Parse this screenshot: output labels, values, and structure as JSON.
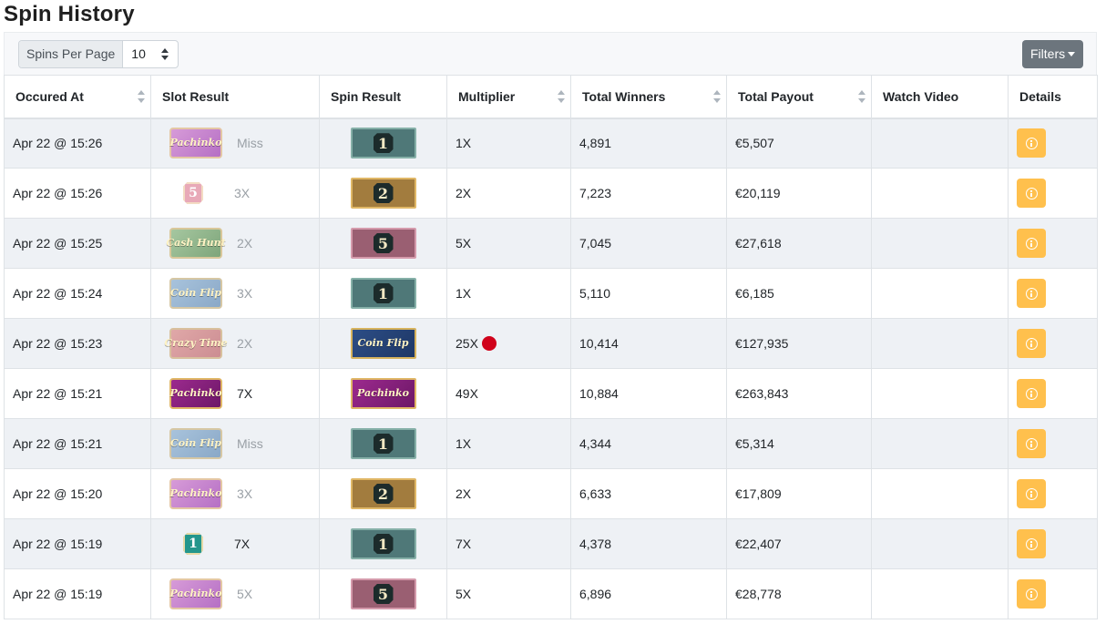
{
  "page": {
    "title": "Spin History"
  },
  "toolbar": {
    "spins_per_page_label": "Spins Per Page",
    "spins_per_page_value": "10",
    "filters_label": "Filters"
  },
  "table": {
    "headers": {
      "occured_at": "Occured At",
      "slot_result": "Slot Result",
      "spin_result": "Spin Result",
      "multiplier": "Multiplier",
      "total_winners": "Total Winners",
      "total_payout": "Total Payout",
      "watch_video": "Watch Video",
      "details": "Details"
    },
    "rows": [
      {
        "occured_at": "Apr 22 @ 15:26",
        "slot_result": "Pachinko",
        "slot_multiplier": "Miss",
        "slot_highlight": false,
        "spin_result": "1",
        "multiplier": "1X",
        "winners": "4,891",
        "payout": "€5,507",
        "has_dot": false
      },
      {
        "occured_at": "Apr 22 @ 15:26",
        "slot_result": "5",
        "slot_multiplier": "3X",
        "slot_highlight": false,
        "spin_result": "2",
        "multiplier": "2X",
        "winners": "7,223",
        "payout": "€20,119",
        "has_dot": false
      },
      {
        "occured_at": "Apr 22 @ 15:25",
        "slot_result": "Cash Hunt",
        "slot_multiplier": "2X",
        "slot_highlight": false,
        "spin_result": "5",
        "multiplier": "5X",
        "winners": "7,045",
        "payout": "€27,618",
        "has_dot": false
      },
      {
        "occured_at": "Apr 22 @ 15:24",
        "slot_result": "Coin Flip",
        "slot_multiplier": "3X",
        "slot_highlight": false,
        "spin_result": "1",
        "multiplier": "1X",
        "winners": "5,110",
        "payout": "€6,185",
        "has_dot": false
      },
      {
        "occured_at": "Apr 22 @ 15:23",
        "slot_result": "Crazy Time",
        "slot_multiplier": "2X",
        "slot_highlight": false,
        "spin_result": "Coin Flip",
        "multiplier": "25X",
        "winners": "10,414",
        "payout": "€127,935",
        "has_dot": true
      },
      {
        "occured_at": "Apr 22 @ 15:21",
        "slot_result": "Pachinko",
        "slot_multiplier": "7X",
        "slot_highlight": true,
        "spin_result": "Pachinko",
        "multiplier": "49X",
        "winners": "10,884",
        "payout": "€263,843",
        "has_dot": false
      },
      {
        "occured_at": "Apr 22 @ 15:21",
        "slot_result": "Coin Flip",
        "slot_multiplier": "Miss",
        "slot_highlight": false,
        "spin_result": "1",
        "multiplier": "1X",
        "winners": "4,344",
        "payout": "€5,314",
        "has_dot": false
      },
      {
        "occured_at": "Apr 22 @ 15:20",
        "slot_result": "Pachinko",
        "slot_multiplier": "3X",
        "slot_highlight": false,
        "spin_result": "2",
        "multiplier": "2X",
        "winners": "6,633",
        "payout": "€17,809",
        "has_dot": false
      },
      {
        "occured_at": "Apr 22 @ 15:19",
        "slot_result": "1",
        "slot_multiplier": "7X",
        "slot_highlight": true,
        "spin_result": "1",
        "multiplier": "7X",
        "winners": "4,378",
        "payout": "€22,407",
        "has_dot": false
      },
      {
        "occured_at": "Apr 22 @ 15:19",
        "slot_result": "Pachinko",
        "slot_multiplier": "5X",
        "slot_highlight": false,
        "spin_result": "5",
        "multiplier": "5X",
        "winners": "6,896",
        "payout": "€28,778",
        "has_dot": false
      }
    ]
  },
  "colors": {
    "details_button": "#ffc04d",
    "filters_button": "#6c757d",
    "stripe": "#eef1f5",
    "dot": "#d0021b"
  }
}
